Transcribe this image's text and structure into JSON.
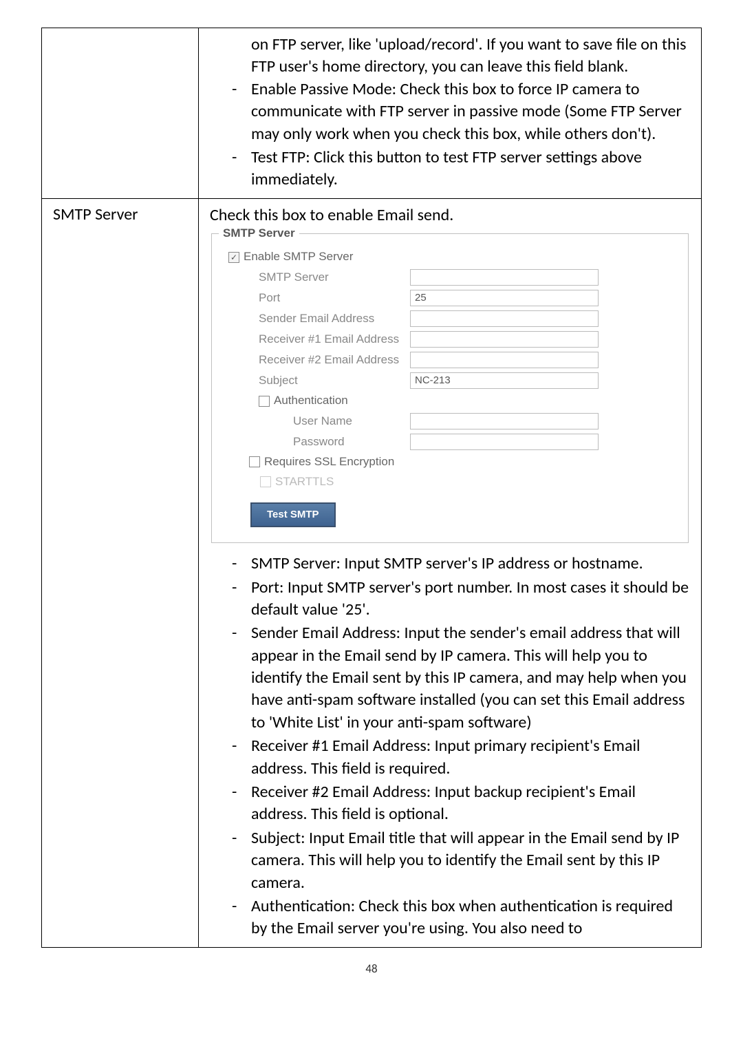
{
  "row1": {
    "para1": "on FTP server, like 'upload/record'. If you want to save file on this FTP user's home directory, you can leave this field blank.",
    "bullet2": "Enable Passive Mode: Check this box to force IP camera to communicate with FTP server in passive mode (Some FTP Server may only work when you check this box, while others don't).",
    "bullet3": "Test FTP: Click this button to test FTP server settings above immediately."
  },
  "row2": {
    "label": "SMTP Server",
    "intro": "Check this box to enable Email send.",
    "panel": {
      "legend": "SMTP Server",
      "enable_label": "Enable SMTP Server",
      "fields": {
        "smtp_server_label": "SMTP Server",
        "smtp_server_value": "",
        "port_label": "Port",
        "port_value": "25",
        "sender_label": "Sender Email Address",
        "sender_value": "",
        "recv1_label": "Receiver #1 Email Address",
        "recv1_value": "",
        "recv2_label": "Receiver #2 Email Address",
        "recv2_value": "",
        "subject_label": "Subject",
        "subject_value": "NC-213",
        "auth_label": "Authentication",
        "user_label": "User Name",
        "user_value": "",
        "pass_label": "Password",
        "pass_value": "",
        "ssl_label": "Requires SSL Encryption",
        "starttls_label": "STARTTLS",
        "test_btn": "Test SMTP"
      }
    },
    "bullets": {
      "b1": "SMTP Server: Input SMTP server's IP address or hostname.",
      "b2": "Port: Input SMTP server's port number. In most cases it should be default value '25'.",
      "b3": "Sender Email Address: Input the sender's email address that will appear in the Email send by IP camera. This will help you to identify the Email sent by this IP camera, and may help when you have anti-spam software installed (you can set this Email address to 'White List' in your anti-spam software)",
      "b4": "Receiver #1 Email Address: Input primary recipient's Email address. This field is required.",
      "b5": "Receiver #2 Email Address: Input backup recipient's Email address. This field is optional.",
      "b6": "Subject: Input Email title that will appear in the Email send by IP camera. This will help you to identify the Email sent by this IP camera.",
      "b7": "Authentication: Check this box when authentication is required by the Email server you're using. You also need to"
    }
  },
  "pagenum": "48"
}
